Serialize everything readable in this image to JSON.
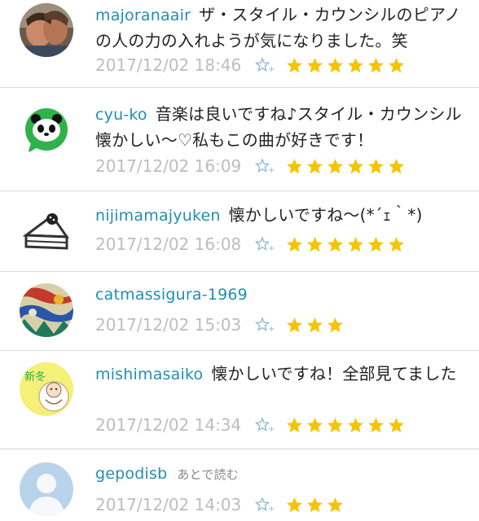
{
  "comments": [
    {
      "user": "majoranaair",
      "text": "ザ・スタイル・カウンシルのピアノの人の力の入れようが気になりました。笑",
      "note": "",
      "date": "2017/12/02 18:46",
      "stars": 6,
      "avatar": "photo-couple-avatar"
    },
    {
      "user": "cyu-ko",
      "text": "音楽は良いですね♪スタイル・カウンシル懐かしい〜♡私もこの曲が好きです！",
      "note": "",
      "date": "2017/12/02 16:09",
      "stars": 6,
      "avatar": "panda-avatar"
    },
    {
      "user": "nijimamajyuken",
      "text": "懐かしいですね〜(*´ｪ｀*)",
      "note": "",
      "date": "2017/12/02 16:08",
      "stars": 6,
      "avatar": "cake-avatar"
    },
    {
      "user": "catmassigura-1969",
      "text": "",
      "note": "",
      "date": "2017/12/02 15:03",
      "stars": 3,
      "avatar": "colorful-pattern-avatar"
    },
    {
      "user": "mishimasaiko",
      "text": "懐かしいですね！全部見てました",
      "note": "",
      "date": "2017/12/02 14:34",
      "stars": 6,
      "avatar": "shinto-baby-avatar"
    },
    {
      "user": "gepodisb",
      "text": "",
      "note": "あとで読む",
      "date": "2017/12/02 14:03",
      "stars": 3,
      "avatar": "default-user-avatar"
    }
  ],
  "avatar_badge_text": "新冬",
  "colors": {
    "username": "#1f8fb0",
    "star": "#f5c400",
    "add_star": "#8ab4d6",
    "date": "#bdbdbd"
  },
  "icons": {
    "star": "star-icon",
    "add_star": "add-star-icon"
  }
}
